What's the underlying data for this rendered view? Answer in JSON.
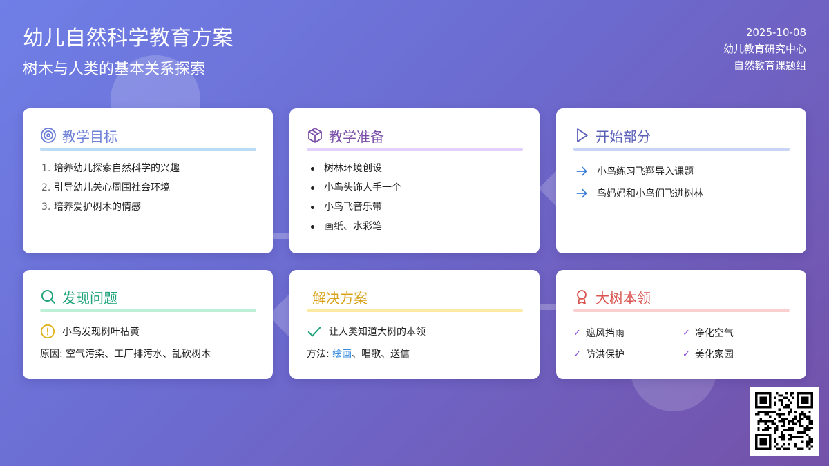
{
  "header": {
    "title": "幼儿自然科学教育方案",
    "subtitle": "树木与人类的基本关系探索",
    "date": "2025-10-08",
    "org": "幼儿教育研究中心",
    "group": "自然教育课题组"
  },
  "colors": {
    "goal": "#6b7fd6",
    "prep": "#7a4fa8",
    "start": "#5a5fb8",
    "discover": "#20a37a",
    "solve": "#d8a21c",
    "tree": "#d9534f"
  },
  "cards": {
    "goal": {
      "title": "教学目标",
      "icon": "target-icon",
      "items": [
        {
          "num": "1.",
          "text": "培养幼儿探索自然科学的兴趣"
        },
        {
          "num": "2.",
          "text": "引导幼儿关心周围社会环境"
        },
        {
          "num": "3.",
          "text": "培养爱护树木的情感"
        }
      ]
    },
    "prep": {
      "title": "教学准备",
      "icon": "box-icon",
      "items": [
        "树林环境创设",
        "小鸟头饰人手一个",
        "小鸟飞音乐带",
        "画纸、水彩笔"
      ]
    },
    "start": {
      "title": "开始部分",
      "icon": "play-icon",
      "items": [
        "小鸟练习飞翔导入课题",
        "鸟妈妈和小鸟们飞进树林"
      ]
    },
    "discover": {
      "title": "发现问题",
      "icon": "search-icon",
      "finding": "小鸟发现树叶枯黄",
      "cause_label": "原因:",
      "cause_underlined": "空气污染",
      "cause_rest": "、工厂排污水、乱砍树木"
    },
    "solve": {
      "title": "解决方案",
      "solution": "让人类知道大树的本领",
      "method_label": "方法:",
      "method_highlight": "绘画",
      "method_rest": "、唱歌、送信"
    },
    "tree": {
      "title": "大树本领",
      "icon": "award-icon",
      "items": [
        "遮风挡雨",
        "净化空气",
        "防洪保护",
        "美化家园"
      ]
    }
  }
}
